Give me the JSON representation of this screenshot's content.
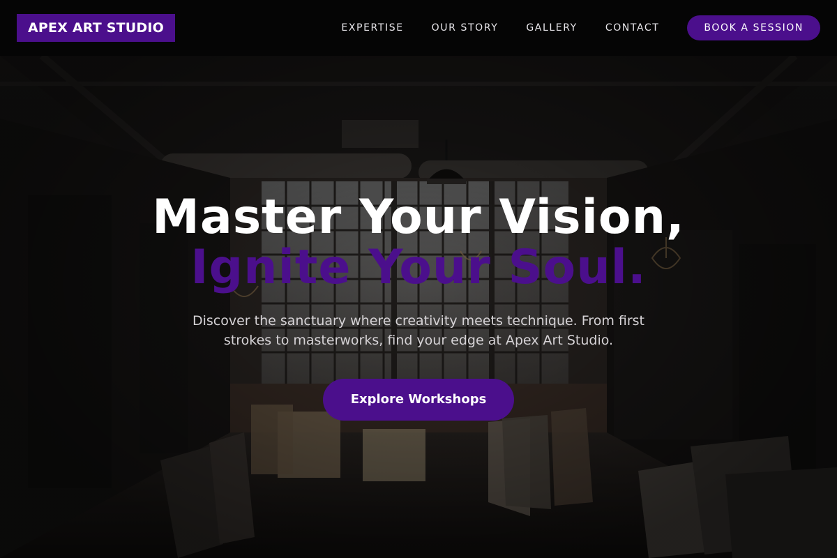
{
  "brand": {
    "name": "APEX ART STUDIO",
    "accent_color": "#4b0f8c"
  },
  "nav": {
    "links": [
      "EXPERTISE",
      "OUR STORY",
      "GALLERY",
      "CONTACT"
    ],
    "cta_label": "BOOK A SESSION"
  },
  "hero": {
    "headline_line1": "Master Your Vision,",
    "headline_line2": "Ignite Your Soul.",
    "subtext": "Discover the sanctuary where creativity meets technique. From first strokes to masterworks, find your edge at Apex Art Studio.",
    "cta_label": "Explore Workshops",
    "background": "dark warehouse art studio with windows, hanging chandeliers, pipes and stacked canvases"
  }
}
